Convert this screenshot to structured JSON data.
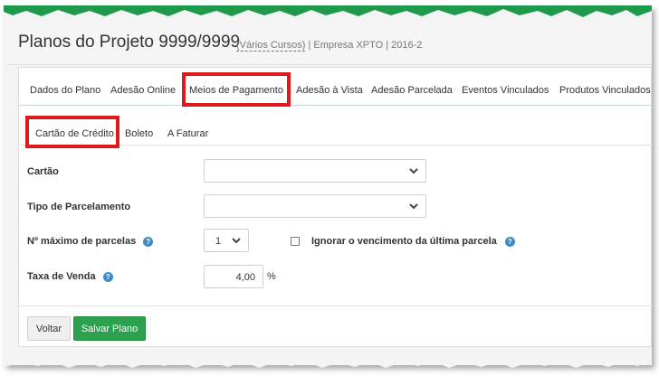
{
  "header": {
    "title": "Planos do Projeto 9999/9999",
    "courses_link": "(Vários Cursos)",
    "meta": "| Empresa XPTO | 2016-2"
  },
  "tabs": [
    {
      "label": "Dados do Plano"
    },
    {
      "label": "Adesão Online"
    },
    {
      "label": "Meios de Pagamento",
      "active": true
    },
    {
      "label": "Adesão à Vista"
    },
    {
      "label": "Adesão Parcelada"
    },
    {
      "label": "Eventos Vinculados"
    },
    {
      "label": "Produtos Vinculados"
    }
  ],
  "subtabs": [
    {
      "label": "Cartão de Crédito",
      "active": true
    },
    {
      "label": "Boleto"
    },
    {
      "label": "A Faturar"
    }
  ],
  "form": {
    "card_label": "Cartão",
    "card_value": "",
    "installment_type_label": "Tipo de Parcelamento",
    "installment_type_value": "",
    "max_installments_label": "Nº máximo de parcelas",
    "max_installments_value": "1",
    "ignore_due_label": "Ignorar o vencimento da última parcela",
    "ignore_due_checked": false,
    "sale_fee_label": "Taxa de Venda",
    "sale_fee_value": "4,00",
    "sale_fee_unit": "%"
  },
  "actions": {
    "back_label": "Voltar",
    "save_label": "Salvar Plano"
  },
  "colors": {
    "highlight": "#e0191f",
    "save_button": "#2ca24f",
    "help_icon": "#3a8bc7",
    "top_strip": "#1f9a4d"
  },
  "icons": {
    "help": "question-circle-icon",
    "dropdown": "chevron-down-icon"
  }
}
